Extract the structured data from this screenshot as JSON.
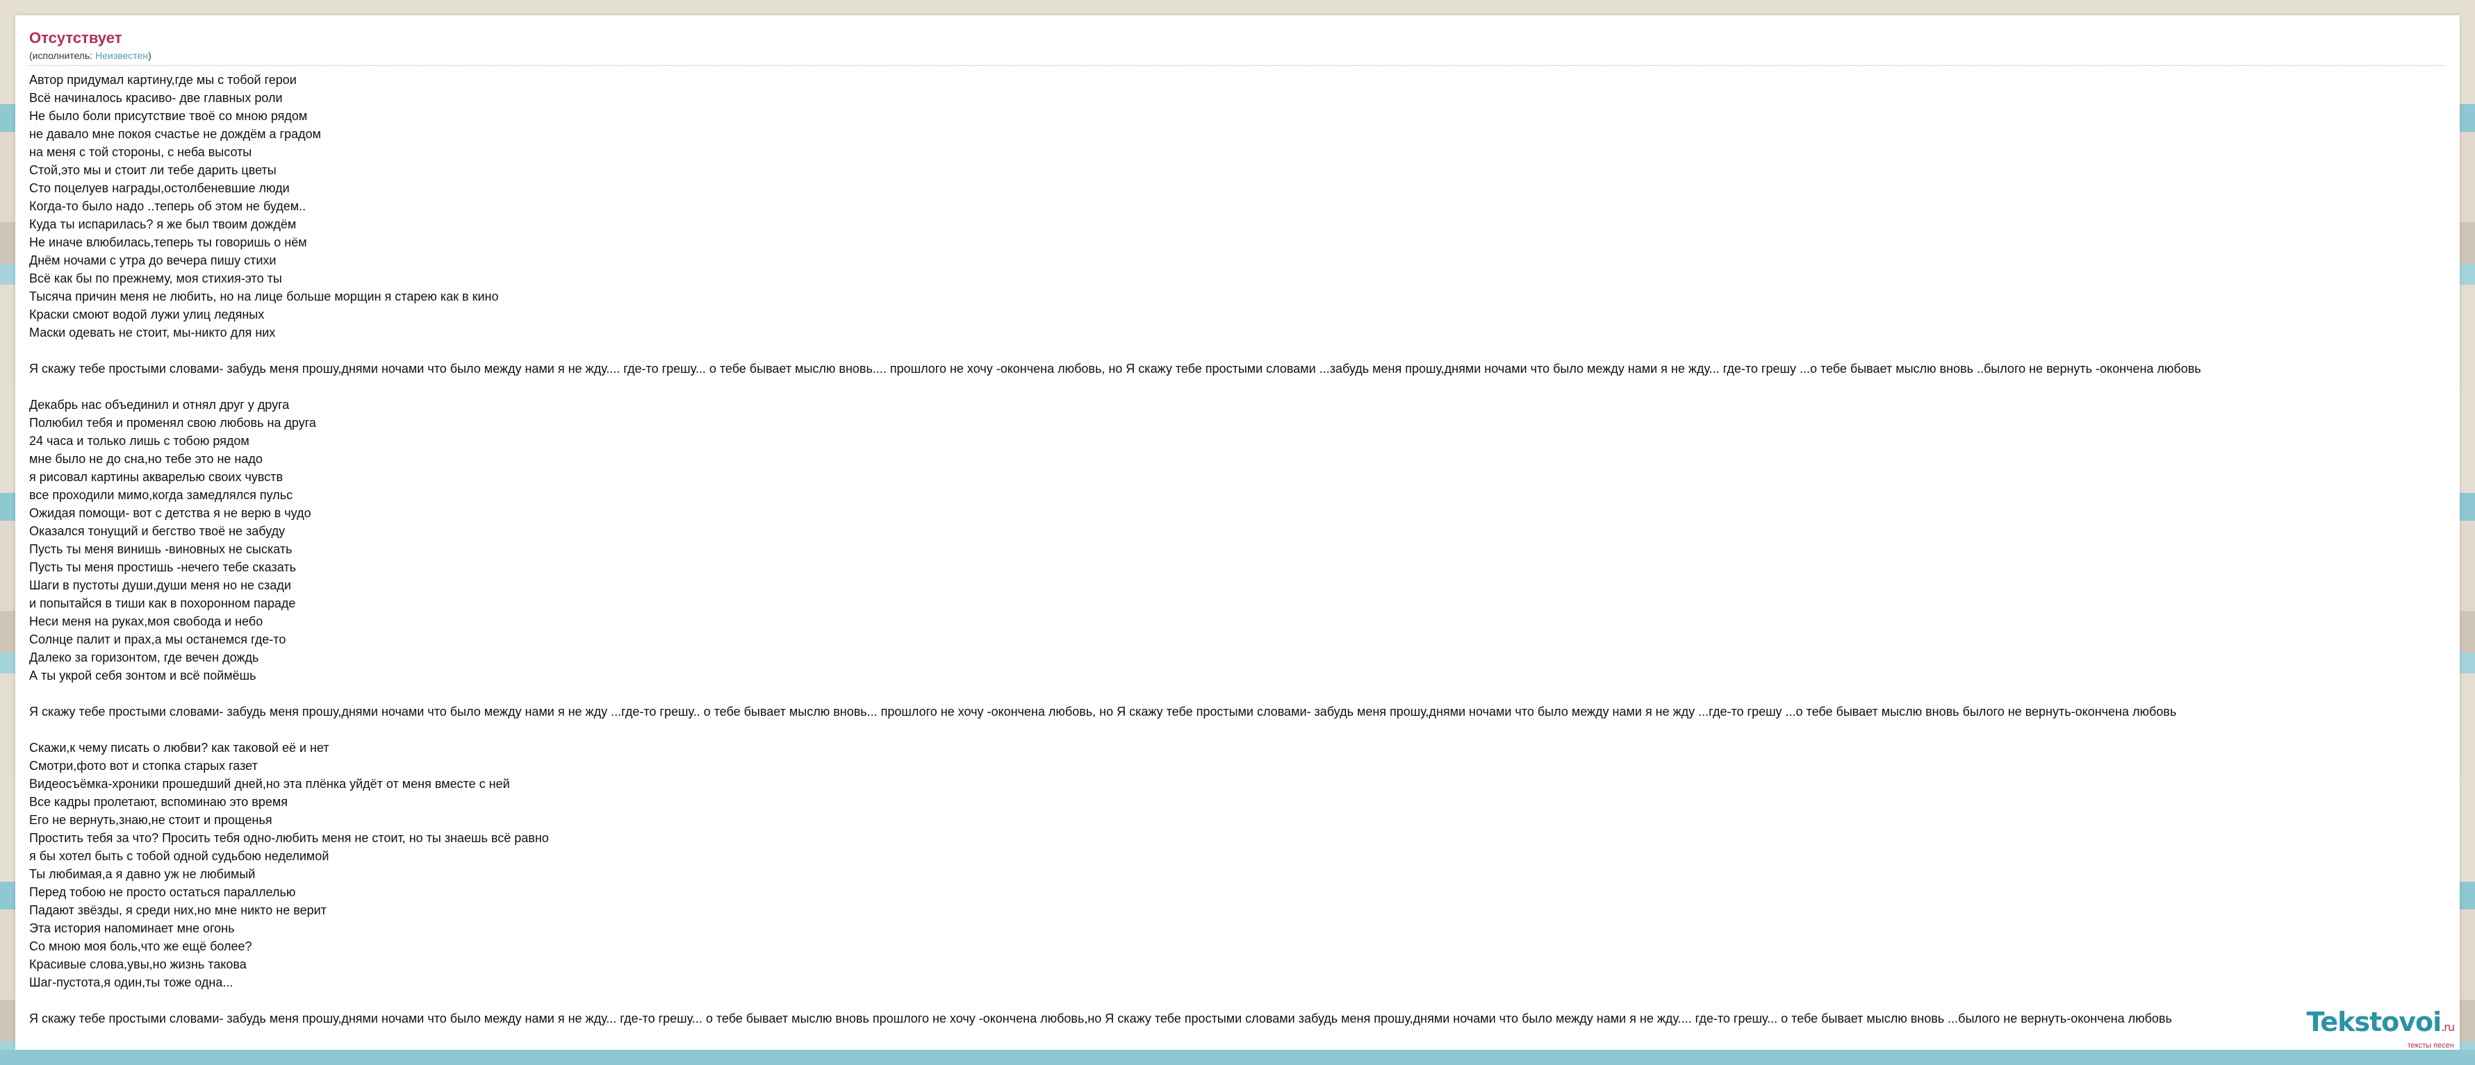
{
  "song": {
    "title": "Отсутствует",
    "artist_prefix": "(исполнитель: ",
    "artist": "Неизвестен",
    "artist_suffix": ")"
  },
  "lyrics": [
    "Автор придумал картину,где мы с тобой герои",
    "Всё начиналось красиво- две главных роли",
    "Не было боли присутствие твоё со мною рядом",
    "не давало мне покоя счастье не дождём а градом",
    "на меня с той стороны, с неба высоты",
    "Стой,это мы и стоит ли тебе дарить цветы",
    "Сто поцелуев награды,остолбеневшие люди",
    "Когда-то было надо ..теперь об этом не будем..",
    "Куда ты испарилась? я же был твоим дождём",
    "Не иначе влюбилась,теперь ты говоришь о нём",
    "Днём ночами с утра до вечера пишу стихи",
    "Всё как бы по прежнему, моя стихия-это ты",
    "Тысяча причин меня не любить, но на лице больше морщин я старею как в кино",
    "Краски смоют водой лужи улиц ледяных",
    "Маски одевать не стоит, мы-никто для них",
    "",
    "Я скажу тебе простыми словами- забудь меня прошу,днями ночами что было между нами я не жду.... где-то грешу... о тебе бывает мыслю вновь.... прошлого не хочу -окончена любовь, но Я скажу тебе простыми словами ...забудь меня прошу,днями ночами что было между нами я не жду... где-то грешу ...о тебе бывает мыслю вновь ..былого не вернуть -окончена любовь",
    "",
    "Декабрь нас объединил и отнял друг у друга",
    "Полюбил тебя и променял свою любовь на друга",
    "24 часа и только лишь с тобою рядом",
    "мне было не до сна,но тебе это не надо",
    "я рисовал картины акварелью своих чувств",
    "все проходили мимо,когда замедлялся пульс",
    "Ожидая помощи- вот с детства я не верю в чудо",
    "Оказался тонущий и бегство твоё не забуду",
    "Пусть ты меня винишь -виновных не сыскать",
    "Пусть ты меня простишь -нечего тебе сказать",
    "Шаги в пустоты души,души меня но не сзади",
    "и попытайся в тиши как в похоронном параде",
    "Неси меня на руках,моя свобода и небо",
    "Солнце палит и прах,а мы останемся где-то",
    "Далеко за горизонтом, где вечен дождь",
    "А ты укрой себя зонтом и всё поймёшь",
    "",
    "Я скажу тебе простыми словами- забудь меня прошу,днями ночами что было между нами я не жду ...где-то грешу.. о тебе бывает мыслю вновь... прошлого не хочу -окончена любовь, но Я скажу тебе простыми словами- забудь меня прошу,днями ночами что было между нами я не жду ...где-то грешу ...о тебе бывает мыслю вновь былого не вернуть-окончена любовь",
    "",
    "Скажи,к чему писать о любви? как таковой её и нет",
    "Смотри,фото вот и стопка старых газет",
    "Видеосъёмка-хроники прошедший дней,но эта плёнка уйдёт от меня вместе с ней",
    "Все кадры пролетают, вспоминаю это время",
    "Его не вернуть,знаю,не стоит и прощенья",
    "Простить тебя за что? Просить тебя одно-любить меня не стоит, но ты знаешь всё равно",
    "я бы хотел быть с тобой одной судьбою неделимой",
    "Ты любимая,а я давно уж не любимый",
    "Перед тобою не просто остаться параллелью",
    "Падают звёзды, я среди них,но мне никто не верит",
    "Эта история напоминает мне огонь",
    "Со мною моя боль,что же ещё более?",
    "Красивые слова,увы,но жизнь такова",
    "Шаг-пустота,я один,ты тоже одна...",
    "",
    "Я скажу тебе простыми словами- забудь меня прошу,днями ночами что было между нами я не жду... где-то грешу... о тебе бывает мыслю вновь прошлого не хочу -окончена любовь,но Я скажу тебе простыми словами забудь меня прошу,днями ночами что было между нами я не жду.... где-то грешу... о тебе бывает мыслю вновь ...былого не вернуть-окончена любовь"
  ],
  "logo": {
    "main": "Tekstovoi",
    "tld": ".ru",
    "tagline": "тексты песен"
  }
}
